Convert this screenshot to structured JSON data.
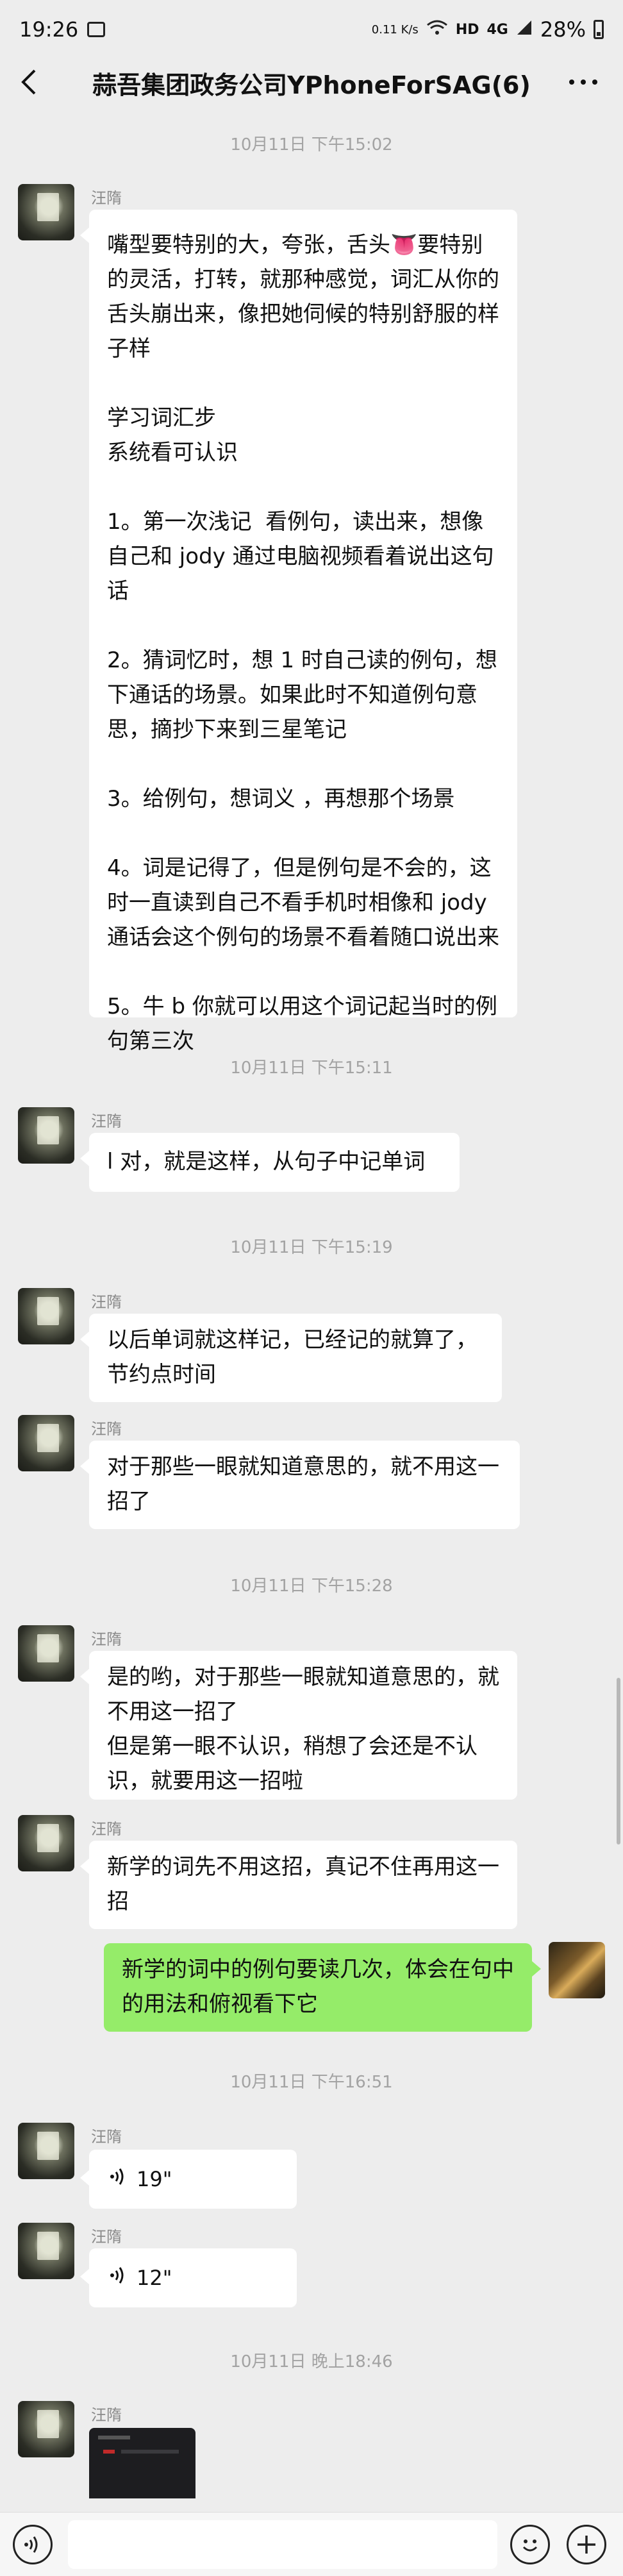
{
  "status_bar": {
    "time": "19:26",
    "network_speed": "0.11 K/s",
    "hd_label": "HD",
    "signal_label": "4G",
    "battery": "28%"
  },
  "header": {
    "back_icon": "chevron-left-icon",
    "title": "蒜吾集团政务公司YPhoneForSAG(6)",
    "more_icon": "more-dots-icon"
  },
  "messages": {
    "ts1": "10月11日 下午15:02",
    "m1_sender": "汪隋",
    "m1_text": "嘴型要特别的大，夸张，舌头👅要特别的灵活，打转，就那种感觉，词汇从你的舌头崩出来，像把她伺候的特别舒服的样子样\n\n学习词汇步\n系统看可认识\n\n1。第一次浅记  看例句，读出来，想像自己和 jody 通过电脑视频看着说出这句话\n\n2。猜词忆时，想 1 时自己读的例句，想下通话的场景。如果此时不知道例句意思，摘抄下来到三星笔记\n\n3。给例句，想词义 ，再想那个场景\n\n4。词是记得了，但是例句是不会的，这时一直读到自己不看手机时相像和 jody 通话会这个例句的场景不看着随口说出来\n\n5。牛 b 你就可以用这个词记起当时的例句第三次",
    "ts2": "10月11日 下午15:11",
    "m2_sender": "汪隋",
    "m2_text": "l 对，就是这样，从句子中记单词",
    "ts3": "10月11日 下午15:19",
    "m3_sender": "汪隋",
    "m3_text": "以后单词就这样记，已经记的就算了，节约点时间",
    "m4_sender": "汪隋",
    "m4_text": "对于那些一眼就知道意思的，就不用这一招了",
    "ts4": "10月11日 下午15:28",
    "m5_sender": "汪隋",
    "m5_text": "是的哟，对于那些一眼就知道意思的，就不用这一招了\n但是第一眼不认识，稍想了会还是不认识，就要用这一招啦",
    "m6_sender": "汪隋",
    "m6_text": "新学的词先不用这招，真记不住再用这一招",
    "m7_text": "新学的词中的例句要读几次，体会在句中的用法和俯视看下它",
    "ts5": "10月11日 下午16:51",
    "m8_sender": "汪隋",
    "m8_duration": "19\"",
    "m9_sender": "汪隋",
    "m9_duration": "12\"",
    "ts6": "10月11日 晚上18:46",
    "m10_sender": "汪隋"
  },
  "input_bar": {
    "voice_icon": "voice-input-icon",
    "emoji_icon": "emoji-icon",
    "plus_icon": "plus-icon"
  },
  "colors": {
    "background": "#ededed",
    "bubble_other": "#ffffff",
    "bubble_self": "#95ec69",
    "timestamp": "#a3a3a3"
  }
}
